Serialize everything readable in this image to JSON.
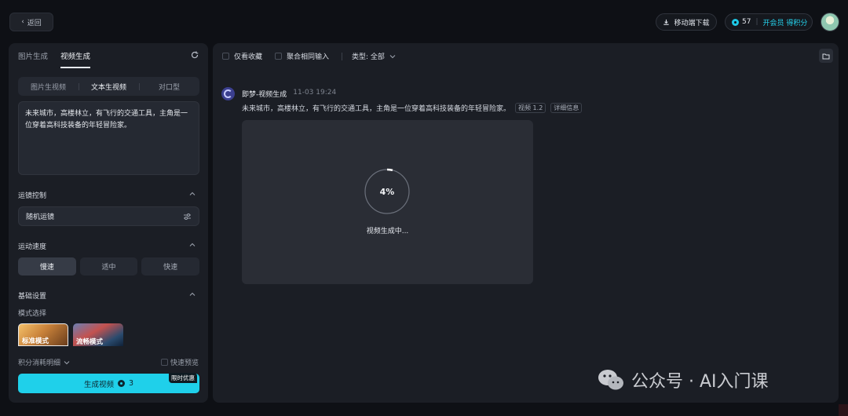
{
  "topbar": {
    "back_label": "返回",
    "download_label": "移动端下载",
    "credits": "57",
    "member_label": "开会员 得积分"
  },
  "left": {
    "tabs": [
      "图片生成",
      "视频生成"
    ],
    "subtabs": [
      "图片生视频",
      "文本生视频",
      "对口型"
    ],
    "prompt": "未来城市，高楼林立，有飞行的交通工具，主角是一位穿着高科技装备的年轻冒险家。",
    "camera_section": "运镜控制",
    "camera_value": "随机运镜",
    "speed_section": "运动速度",
    "speeds": [
      "慢速",
      "适中",
      "快速"
    ],
    "basic_section": "基础设置",
    "mode_label": "模式选择",
    "modes": [
      "标准模式",
      "流畅模式"
    ],
    "cost_label": "积分消耗明细",
    "fast_preview": "快速预览",
    "generate_label": "生成视频",
    "generate_cost": "3",
    "promo": "限时优惠"
  },
  "right": {
    "filters": [
      "仅看收藏",
      "聚合相同输入",
      "类型: 全部"
    ],
    "gen_title": "即梦-视频生成",
    "gen_time": "11-03  19:24",
    "gen_prompt": "未来城市，高楼林立，有飞行的交通工具，主角是一位穿着高科技装备的年轻冒险家。",
    "tags": [
      "视频 1.2",
      "详细信息"
    ],
    "progress_text": "4%",
    "progress_value": 0.04,
    "progress_label": "视频生成中..."
  },
  "watermark": "公众号 · AI入门课",
  "colors": {
    "accent": "#1fd0ea",
    "panel": "#1b1e25",
    "bg": "#0e1015"
  }
}
